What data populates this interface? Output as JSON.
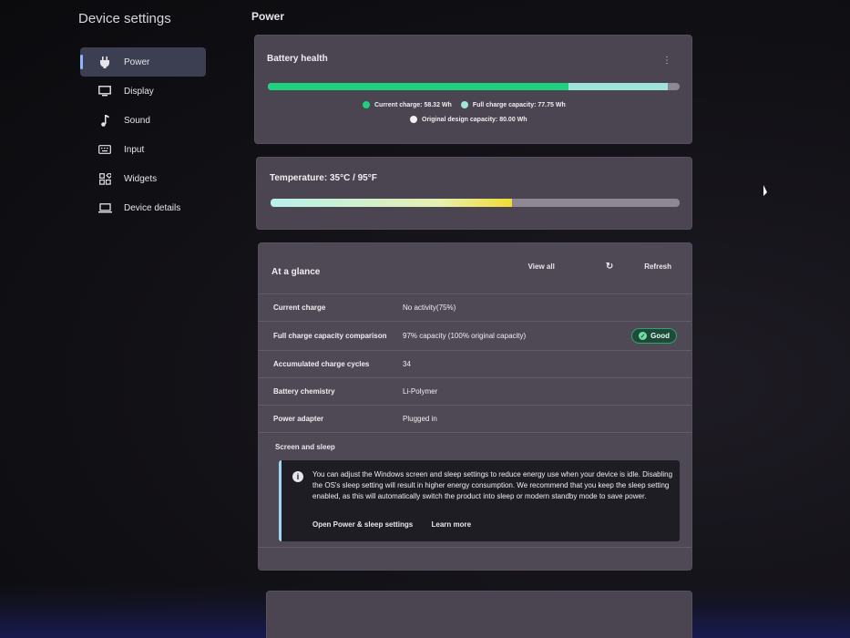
{
  "app_title": "Device settings",
  "sidebar": {
    "items": [
      {
        "label": "Power",
        "icon": "plug-icon",
        "active": true
      },
      {
        "label": "Display",
        "icon": "monitor-icon"
      },
      {
        "label": "Sound",
        "icon": "music-note-icon"
      },
      {
        "label": "Input",
        "icon": "keyboard-icon"
      },
      {
        "label": "Widgets",
        "icon": "widgets-icon"
      },
      {
        "label": "Device details",
        "icon": "laptop-icon"
      }
    ]
  },
  "page_title": "Power",
  "battery": {
    "title": "Battery health",
    "current_charge_label": "Current charge: 58.32 Wh",
    "full_capacity_label": "Full charge capacity: 77.75 Wh",
    "design_capacity_label": "Original design capacity: 80.00 Wh",
    "current_charge_wh": 58.32,
    "full_capacity_wh": 77.75,
    "design_capacity_wh": 80.0,
    "colors": {
      "current": "#1fd17e",
      "full": "#9fe5dc",
      "design": "#8e8794"
    }
  },
  "temperature": {
    "title": "Temperature:  35°C / 95°F",
    "fill_fraction": 0.59
  },
  "glance": {
    "title": "At a glance",
    "view_all": "View all",
    "refresh": "Refresh",
    "rows": [
      {
        "label": "Current charge",
        "value": "No activity(75%)"
      },
      {
        "label": "Full charge capacity comparison",
        "value": "97% capacity (100% original capacity)",
        "badge": "Good"
      },
      {
        "label": "Accumulated charge cycles",
        "value": "34"
      },
      {
        "label": "Battery chemistry",
        "value": "Li-Polymer"
      },
      {
        "label": "Power adapter",
        "value": "Plugged in"
      }
    ],
    "sleep": {
      "title": "Screen and sleep",
      "info": "You can adjust the Windows screen and sleep settings to reduce energy use when your device is idle. Disabling the OS's sleep setting will result in higher energy consumption. We recommend that you keep the sleep setting enabled, as this will automatically switch the product into sleep or modern standby mode to save power.",
      "link_settings": "Open Power & sleep settings",
      "link_learn": "Learn more"
    }
  }
}
